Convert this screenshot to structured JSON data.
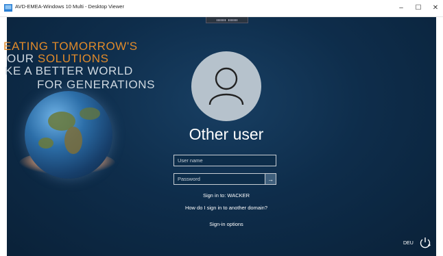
{
  "window": {
    "title": "AVD-EMEA-Windows 10 Multi - Desktop Viewer",
    "minimize_glyph": "–",
    "maximize_glyph": "☐",
    "close_glyph": "✕"
  },
  "wallpaper": {
    "slogan": [
      "EATING TOMORROW'S",
      "OUR",
      "SOLUTIONS",
      "KE A BETTER WORLD",
      "FOR GENERATIONS"
    ],
    "accent_color": "#e08a2a"
  },
  "login": {
    "user_title": "Other user",
    "username_placeholder": "User name",
    "password_placeholder": "Password",
    "submit_glyph": "→",
    "sign_in_to": "Sign in to: WACKER",
    "another_domain": "How do I sign in to another domain?",
    "sign_in_options": "Sign-in options"
  },
  "tray": {
    "language": "DEU",
    "icons": [
      "power-icon",
      "avatar-icon",
      "app-icon"
    ]
  }
}
